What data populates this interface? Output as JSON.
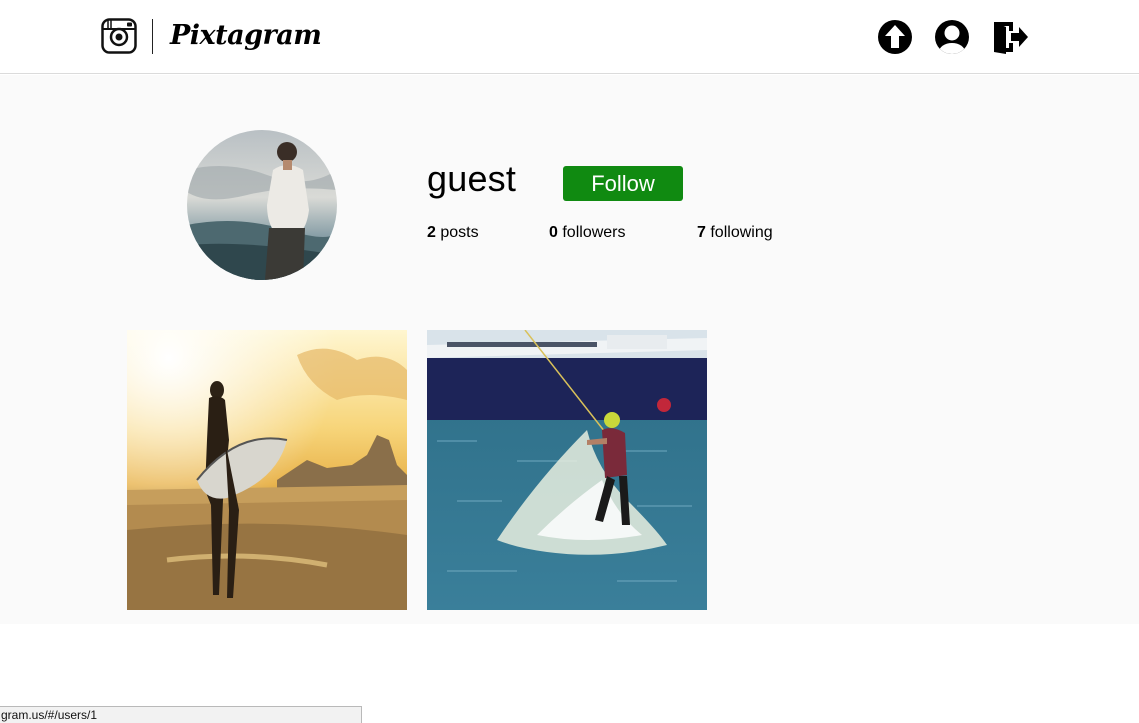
{
  "app": {
    "name": "Pixtagram"
  },
  "header": {
    "logo_icon": "camera-icon",
    "nav": [
      {
        "name": "upload",
        "icon": "upload-arrow-icon"
      },
      {
        "name": "profile",
        "icon": "user-icon"
      },
      {
        "name": "logout",
        "icon": "logout-door-icon"
      }
    ]
  },
  "profile": {
    "username": "guest",
    "follow_label": "Follow",
    "posts_count": "2",
    "posts_label": "posts",
    "followers_count": "0",
    "followers_label": "followers",
    "following_count": "7",
    "following_label": "following"
  },
  "posts": [
    {
      "subject": "surfer-silhouette-at-sunset"
    },
    {
      "subject": "wakeboarder-on-water"
    }
  ],
  "status_bar": {
    "url": "gram.us/#/users/1"
  },
  "colors": {
    "follow_button": "#108a11",
    "background": "#fafafa",
    "header_border": "#dbdbdb"
  }
}
